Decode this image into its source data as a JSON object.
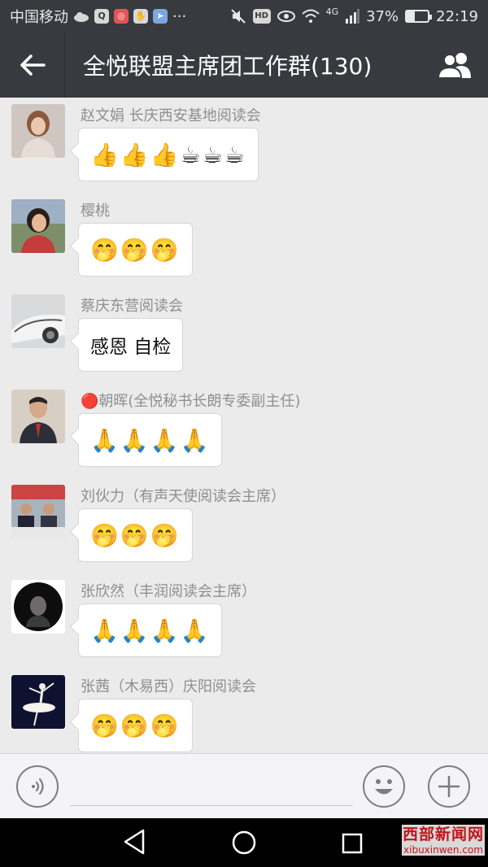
{
  "status_bar": {
    "carrier": "中国移动",
    "hd": "HD",
    "network": "4G",
    "battery": "37%",
    "battery_level": 0.37,
    "time": "22:19",
    "dots": "···"
  },
  "header": {
    "title": "全悦联盟主席团工作群(130)",
    "back_icon": "arrow-left-icon",
    "members_icon": "group-members-icon"
  },
  "messages": [
    {
      "sender": "赵文娟 长庆西安基地阅读会",
      "content": "👍👍👍☕☕☕",
      "type": "emoji"
    },
    {
      "sender": "樱桃",
      "content": "🤭🤭🤭",
      "type": "emoji"
    },
    {
      "sender": "蔡庆东营阅读会",
      "content": "感恩 自检",
      "type": "text"
    },
    {
      "sender": "🔴朝晖(全悦秘书长朗专委副主任)",
      "content": "🙏🙏🙏🙏",
      "type": "emoji"
    },
    {
      "sender": "刘伙力（有声天使阅读会主席）",
      "content": "🤭🤭🤭",
      "type": "emoji"
    },
    {
      "sender": "张欣然（丰润阅读会主席）",
      "content": "🙏🙏🙏🙏",
      "type": "emoji"
    },
    {
      "sender": "张茜（木易西）庆阳阅读会",
      "content": "🤭🤭🤭",
      "type": "emoji"
    }
  ],
  "input_bar": {
    "placeholder": "",
    "voice_icon": "voice-icon",
    "emoji_icon": "smiley-icon",
    "plus_icon": "plus-icon"
  },
  "nav": {
    "back_icon": "triangle-back-icon",
    "home_icon": "circle-home-icon",
    "recent_icon": "square-recent-icon"
  },
  "watermark": {
    "main": "西部新闻网",
    "sub": "xibuxinwen.com"
  }
}
